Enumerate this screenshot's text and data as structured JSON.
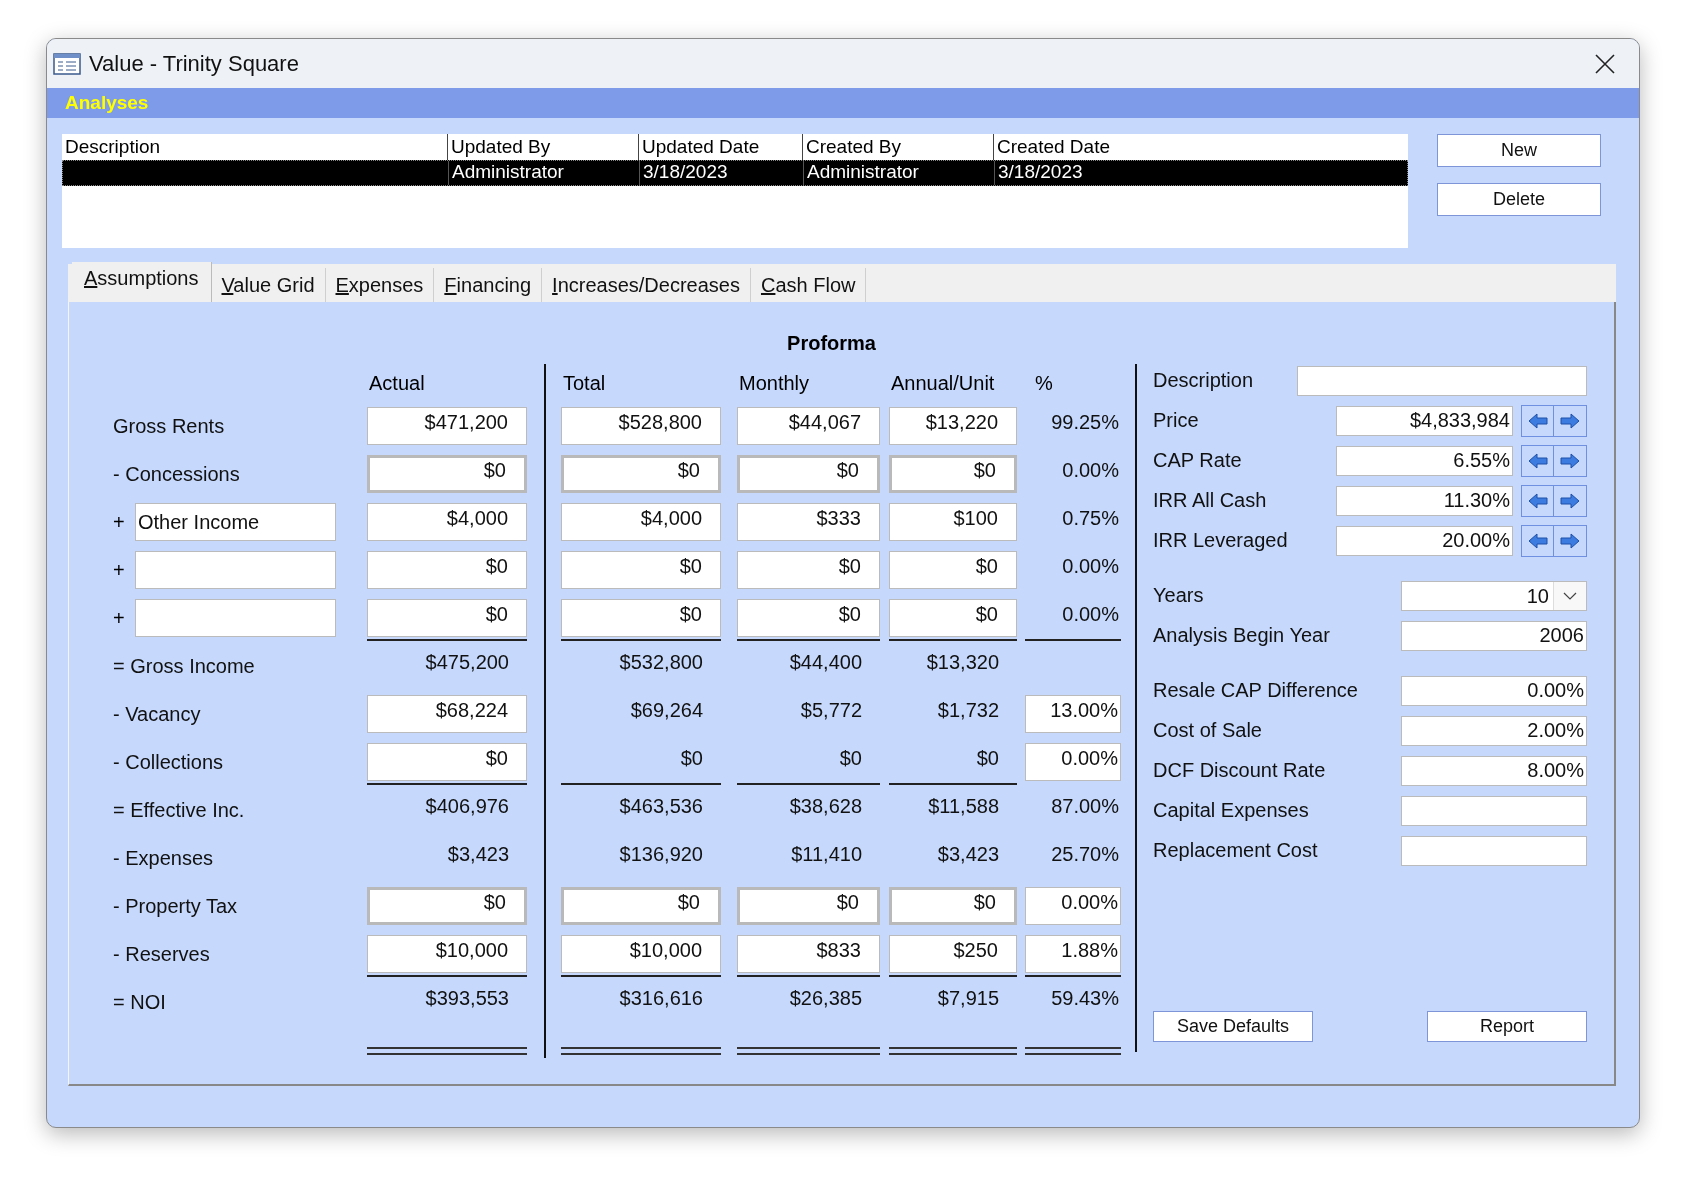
{
  "window": {
    "title": "Value - Trinity Square"
  },
  "section": {
    "title": "Analyses"
  },
  "analyses_list": {
    "columns": [
      "Description",
      "Updated By",
      "Updated Date",
      "Created By",
      "Created Date"
    ],
    "rows": [
      {
        "selected": true,
        "cells": [
          "",
          "Administrator",
          "3/18/2023",
          "Administrator",
          "3/18/2023"
        ]
      }
    ]
  },
  "list_buttons": [
    "New",
    "Delete"
  ],
  "tabs": [
    {
      "label": "Assumptions",
      "selected": true
    },
    {
      "label": "Value Grid",
      "selected": false
    },
    {
      "label": "Expenses",
      "selected": false
    },
    {
      "label": "Financing",
      "selected": false
    },
    {
      "label": "Increases/Decreases",
      "selected": false
    },
    {
      "label": "Cash Flow",
      "selected": false
    }
  ],
  "proforma": {
    "title": "Proforma",
    "columns": [
      "Actual",
      "Total",
      "Monthly",
      "Annual/Unit",
      "%"
    ],
    "rows": [
      {
        "kind": "label",
        "label": "Gross Rents",
        "cells": [
          {
            "value": "$471,200",
            "kind": "input"
          },
          {
            "value": "$528,800",
            "kind": "input"
          },
          {
            "value": "$44,067",
            "kind": "input"
          },
          {
            "value": "$13,220",
            "kind": "input"
          },
          {
            "value": "99.25%",
            "kind": "text"
          }
        ]
      },
      {
        "kind": "label",
        "label": "- Concessions",
        "cells": [
          {
            "value": "$0",
            "kind": "locked"
          },
          {
            "value": "$0",
            "kind": "locked"
          },
          {
            "value": "$0",
            "kind": "locked"
          },
          {
            "value": "$0",
            "kind": "locked"
          },
          {
            "value": "0.00%",
            "kind": "text"
          }
        ]
      },
      {
        "kind": "entry",
        "sign": "+",
        "field": "Other Income",
        "cells": [
          {
            "value": "$4,000",
            "kind": "input"
          },
          {
            "value": "$4,000",
            "kind": "input"
          },
          {
            "value": "$333",
            "kind": "input"
          },
          {
            "value": "$100",
            "kind": "input"
          },
          {
            "value": "0.75%",
            "kind": "text"
          }
        ]
      },
      {
        "kind": "entry",
        "sign": "+",
        "cells": [
          {
            "value": "$0",
            "kind": "input"
          },
          {
            "value": "$0",
            "kind": "input"
          },
          {
            "value": "$0",
            "kind": "input"
          },
          {
            "value": "$0",
            "kind": "input"
          },
          {
            "value": "0.00%",
            "kind": "text"
          }
        ]
      },
      {
        "kind": "entry",
        "sign": "+",
        "cells": [
          {
            "value": "$0",
            "kind": "input",
            "underlined": true
          },
          {
            "value": "$0",
            "kind": "input",
            "underlined": true
          },
          {
            "value": "$0",
            "kind": "input",
            "underlined": true
          },
          {
            "value": "$0",
            "kind": "input",
            "underlined": true
          },
          {
            "value": "0.00%",
            "kind": "text",
            "underlined": true
          }
        ]
      },
      {
        "kind": "label",
        "label": "= Gross Income",
        "cells": [
          {
            "value": "$475,200",
            "kind": "text"
          },
          {
            "value": "$532,800",
            "kind": "text"
          },
          {
            "value": "$44,400",
            "kind": "text"
          },
          {
            "value": "$13,320",
            "kind": "text"
          },
          null
        ]
      },
      {
        "kind": "label",
        "label": "- Vacancy",
        "cells": [
          {
            "value": "$68,224",
            "kind": "input"
          },
          {
            "value": "$69,264",
            "kind": "text"
          },
          {
            "value": "$5,772",
            "kind": "text"
          },
          {
            "value": "$1,732",
            "kind": "text"
          },
          {
            "value": "13.00%",
            "kind": "input"
          }
        ]
      },
      {
        "kind": "label",
        "label": "- Collections",
        "cells": [
          {
            "value": "$0",
            "kind": "input",
            "underlined": true
          },
          {
            "value": "$0",
            "kind": "text",
            "underlined": true
          },
          {
            "value": "$0",
            "kind": "text",
            "underlined": true
          },
          {
            "value": "$0",
            "kind": "text",
            "underlined": true
          },
          {
            "value": "0.00%",
            "kind": "input"
          }
        ]
      },
      {
        "kind": "label",
        "label": "= Effective Inc.",
        "cells": [
          {
            "value": "$406,976",
            "kind": "text"
          },
          {
            "value": "$463,536",
            "kind": "text"
          },
          {
            "value": "$38,628",
            "kind": "text"
          },
          {
            "value": "$11,588",
            "kind": "text"
          },
          {
            "value": "87.00%",
            "kind": "text"
          }
        ]
      },
      {
        "kind": "label",
        "label": "- Expenses",
        "cells": [
          {
            "value": "$3,423",
            "kind": "text"
          },
          {
            "value": "$136,920",
            "kind": "text"
          },
          {
            "value": "$11,410",
            "kind": "text"
          },
          {
            "value": "$3,423",
            "kind": "text"
          },
          {
            "value": "25.70%",
            "kind": "text"
          }
        ]
      },
      {
        "kind": "label",
        "label": "- Property Tax",
        "cells": [
          {
            "value": "$0",
            "kind": "locked"
          },
          {
            "value": "$0",
            "kind": "locked"
          },
          {
            "value": "$0",
            "kind": "locked"
          },
          {
            "value": "$0",
            "kind": "locked"
          },
          {
            "value": "0.00%",
            "kind": "input"
          }
        ]
      },
      {
        "kind": "label",
        "label": "- Reserves",
        "cells": [
          {
            "value": "$10,000",
            "kind": "input",
            "underlined": true
          },
          {
            "value": "$10,000",
            "kind": "input",
            "underlined": true
          },
          {
            "value": "$833",
            "kind": "input",
            "underlined": true
          },
          {
            "value": "$250",
            "kind": "input",
            "underlined": true
          },
          {
            "value": "1.88%",
            "kind": "input",
            "underlined": true
          }
        ]
      },
      {
        "kind": "label",
        "label": "= NOI",
        "cells": [
          {
            "value": "$393,553",
            "kind": "text",
            "double_underlined": true
          },
          {
            "value": "$316,616",
            "kind": "text",
            "double_underlined": true
          },
          {
            "value": "$26,385",
            "kind": "text",
            "double_underlined": true
          },
          {
            "value": "$7,915",
            "kind": "text",
            "double_underlined": true
          },
          {
            "value": "59.43%",
            "kind": "text",
            "double_underlined": true
          }
        ]
      }
    ]
  },
  "settings": {
    "groups": [
      [
        {
          "label": "Description",
          "kind": "wide"
        },
        {
          "label": "Price",
          "kind": "spin",
          "value": "$4,833,984"
        },
        {
          "label": "CAP Rate",
          "kind": "spin",
          "value": "6.55%"
        },
        {
          "label": "IRR All Cash",
          "kind": "spin",
          "value": "11.30%"
        },
        {
          "label": "IRR Leveraged",
          "kind": "spin",
          "value": "20.00%"
        }
      ],
      [
        {
          "label": "Years",
          "kind": "dropdown",
          "value": "10"
        },
        {
          "label": "Analysis Begin Year",
          "kind": "field",
          "value": "2006"
        }
      ],
      [
        {
          "label": "Resale CAP Difference",
          "kind": "field",
          "value": "0.00%"
        },
        {
          "label": "Cost of Sale",
          "kind": "field",
          "value": "2.00%"
        },
        {
          "label": "DCF Discount Rate",
          "kind": "field",
          "value": "8.00%"
        },
        {
          "label": "Capital Expenses",
          "kind": "field"
        },
        {
          "label": "Replacement Cost",
          "kind": "field"
        }
      ]
    ],
    "buttons": [
      "Save Defaults",
      "Report"
    ]
  }
}
